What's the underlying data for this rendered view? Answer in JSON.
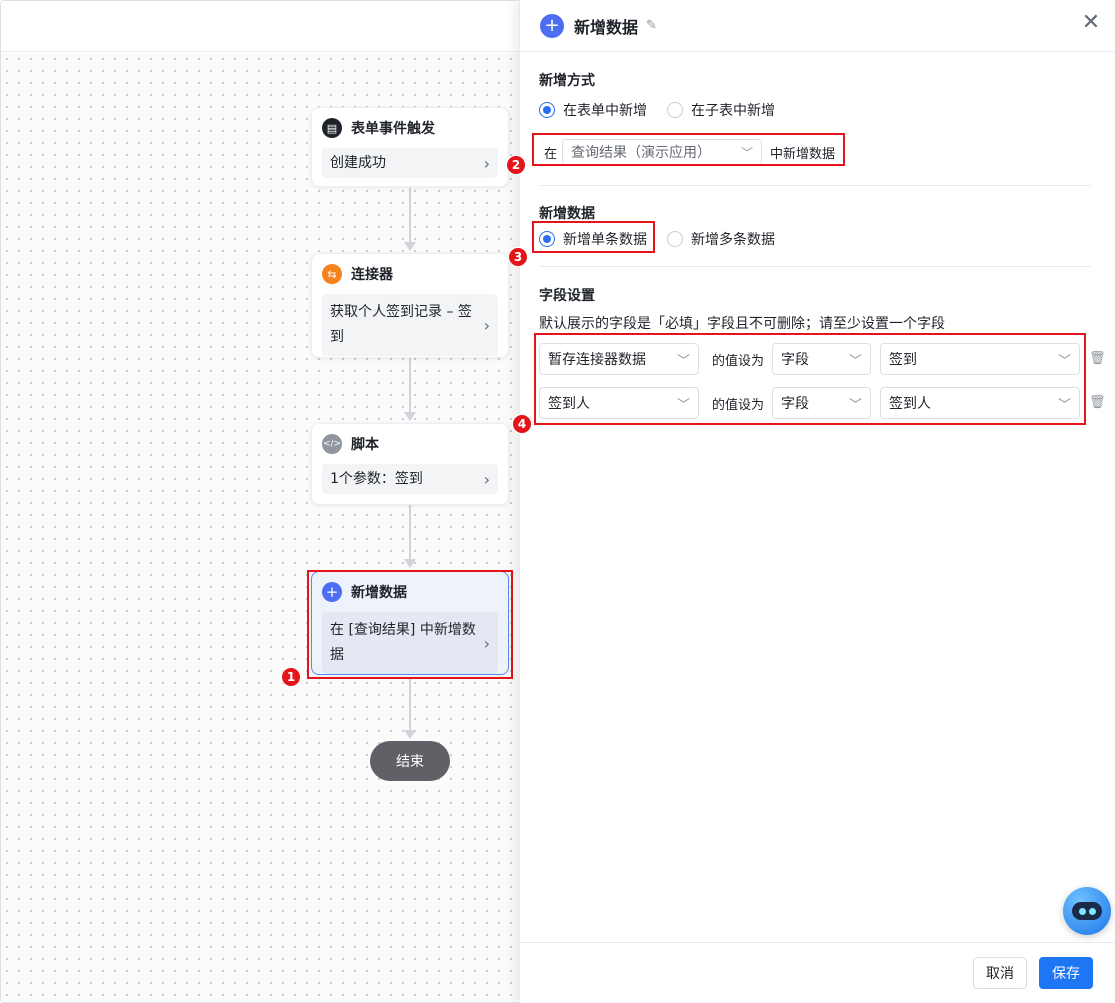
{
  "flow": {
    "nodes": [
      {
        "title": "表单事件触发",
        "body": "创建成功",
        "icon_color": "#1f2329",
        "icon": "document-icon"
      },
      {
        "title": "连接器",
        "body": "获取个人签到记录 – 签到",
        "icon_color": "#f5811f",
        "icon": "connector-icon"
      },
      {
        "title": "脚本",
        "body": "1个参数：签到",
        "icon_color": "#8f959e",
        "icon": "code-icon"
      },
      {
        "title": "新增数据",
        "body": "在 [查询结果] 中新增数据",
        "icon_color": "#4e6ef2",
        "icon": "plus-icon"
      }
    ],
    "end_label": "结束"
  },
  "drawer": {
    "title": "新增数据",
    "add_mode": {
      "title": "新增方式",
      "options": [
        "在表单中新增",
        "在子表中新增"
      ],
      "selected": "在表单中新增",
      "prefix": "在",
      "source": "查询结果（演示应用）",
      "suffix": "中新增数据"
    },
    "add_data": {
      "title": "新增数据",
      "options": [
        "新增单条数据",
        "新增多条数据"
      ],
      "selected": "新增单条数据"
    },
    "fields": {
      "title": "字段设置",
      "hint": "默认展示的字段是「必填」字段且不可删除；请至少设置一个字段",
      "rows": [
        {
          "field": "暂存连接器数据",
          "op": "的值设为",
          "type": "字段",
          "value": "签到"
        },
        {
          "field": "签到人",
          "op": "的值设为",
          "type": "字段",
          "value": "签到人"
        }
      ]
    },
    "footer": {
      "cancel": "取消",
      "save": "保存"
    }
  },
  "annotations": [
    "1",
    "2",
    "3",
    "4"
  ],
  "colors": {
    "primary": "#1f76f5",
    "annotation": "#e5141b"
  }
}
